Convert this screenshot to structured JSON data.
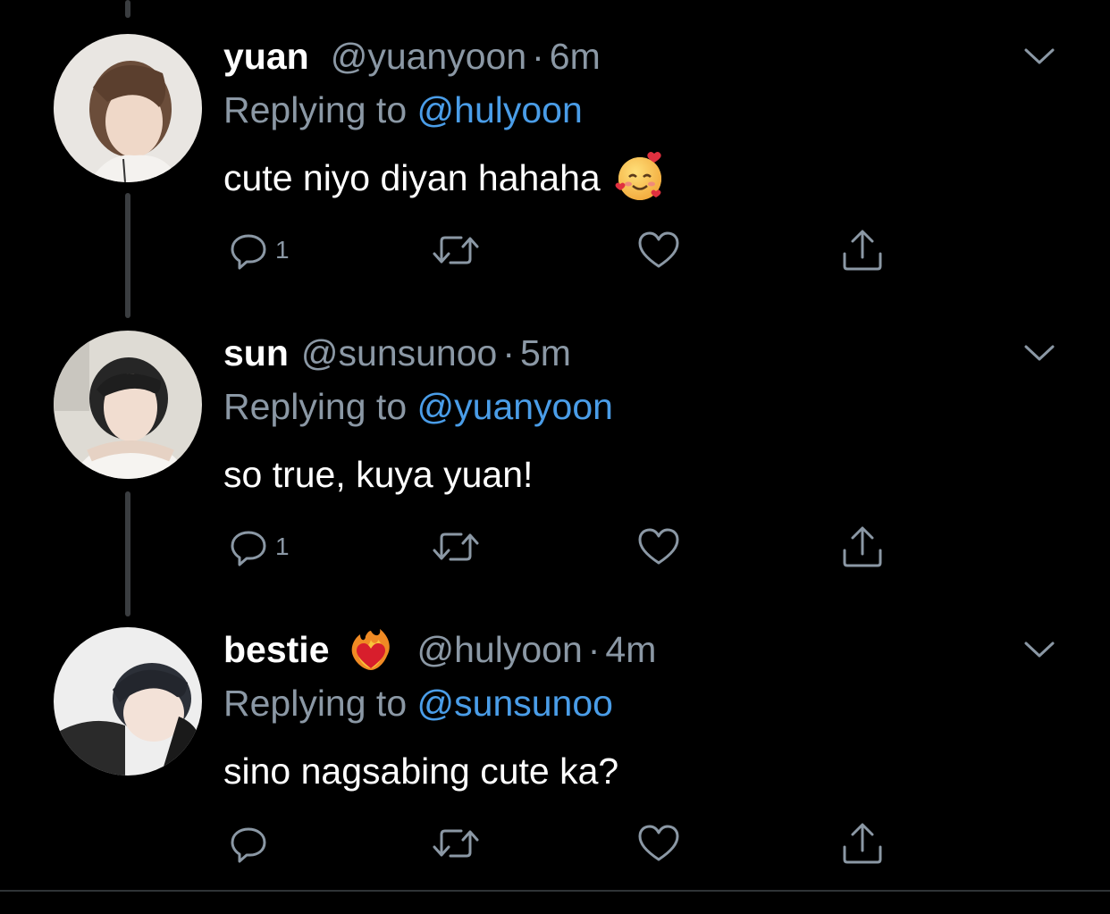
{
  "thread": {
    "tweets": [
      {
        "display_name": "yuan",
        "handle": "@yuanyoon",
        "separator": "·",
        "time": "6m",
        "reply_prefix": "Replying to",
        "reply_to": "@hulyoon",
        "text": "cute niyo diyan hahaha",
        "text_emoji": "smiling-face-with-hearts",
        "reply_count": "1"
      },
      {
        "display_name": "sun",
        "handle": "@sunsunoo",
        "separator": "·",
        "time": "5m",
        "reply_prefix": "Replying to",
        "reply_to": "@yuanyoon",
        "text": "so true, kuya yuan!",
        "reply_count": "1"
      },
      {
        "display_name": "bestie",
        "name_emoji": "heart-on-fire",
        "handle": "@hulyoon",
        "separator": "·",
        "time": "4m",
        "reply_prefix": "Replying to",
        "reply_to": "@sunsunoo",
        "text": "sino nagsabing cute ka?",
        "reply_count": ""
      }
    ]
  },
  "icons": {
    "reply": "reply-icon",
    "retweet": "retweet-icon",
    "like": "heart-icon",
    "share": "share-icon",
    "more": "chevron-down-icon"
  },
  "colors": {
    "background": "#000000",
    "secondary_text": "#8b98a5",
    "link": "#4a9de8",
    "icon": "#8b98a5",
    "thread_line": "#3a3d40"
  }
}
